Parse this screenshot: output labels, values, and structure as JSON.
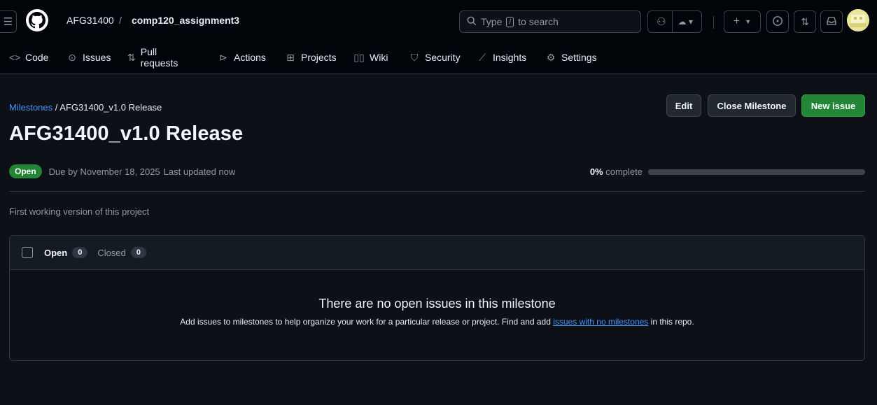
{
  "header": {
    "owner": "AFG31400",
    "separator": "/",
    "repo": "comp120_assignment3",
    "search": {
      "prefix": "Type",
      "key": "/",
      "suffix": "to search"
    }
  },
  "tabs": [
    {
      "label": "Code",
      "icon": "code-icon"
    },
    {
      "label": "Issues",
      "icon": "issue-opened-icon"
    },
    {
      "label": "Pull requests",
      "icon": "git-pull-request-icon"
    },
    {
      "label": "Actions",
      "icon": "play-icon"
    },
    {
      "label": "Projects",
      "icon": "table-icon"
    },
    {
      "label": "Wiki",
      "icon": "book-icon"
    },
    {
      "label": "Security",
      "icon": "shield-icon"
    },
    {
      "label": "Insights",
      "icon": "graph-icon"
    },
    {
      "label": "Settings",
      "icon": "gear-icon"
    }
  ],
  "breadcrumb": {
    "parent": "Milestones",
    "separator": "/",
    "current": "AFG31400_v1.0 Release"
  },
  "milestone": {
    "title": "AFG31400_v1.0 Release",
    "state": "Open",
    "due": "Due by November 18, 2025",
    "updated": "Last updated now",
    "percent_label": "0%",
    "complete_label": "complete",
    "progress": 0,
    "description": "First working version of this project"
  },
  "actions": {
    "edit": "Edit",
    "close": "Close Milestone",
    "new_issue": "New issue"
  },
  "issues": {
    "open_label": "Open",
    "open_count": "0",
    "closed_label": "Closed",
    "closed_count": "0",
    "empty_title": "There are no open issues in this milestone",
    "empty_text_before": "Add issues to milestones to help organize your work for a particular release or project. Find and add",
    "empty_link": "issues with no milestones",
    "empty_text_after": "in this repo."
  },
  "colors": {
    "accent": "#4493f8",
    "success": "#238636",
    "background": "#0d1117"
  }
}
